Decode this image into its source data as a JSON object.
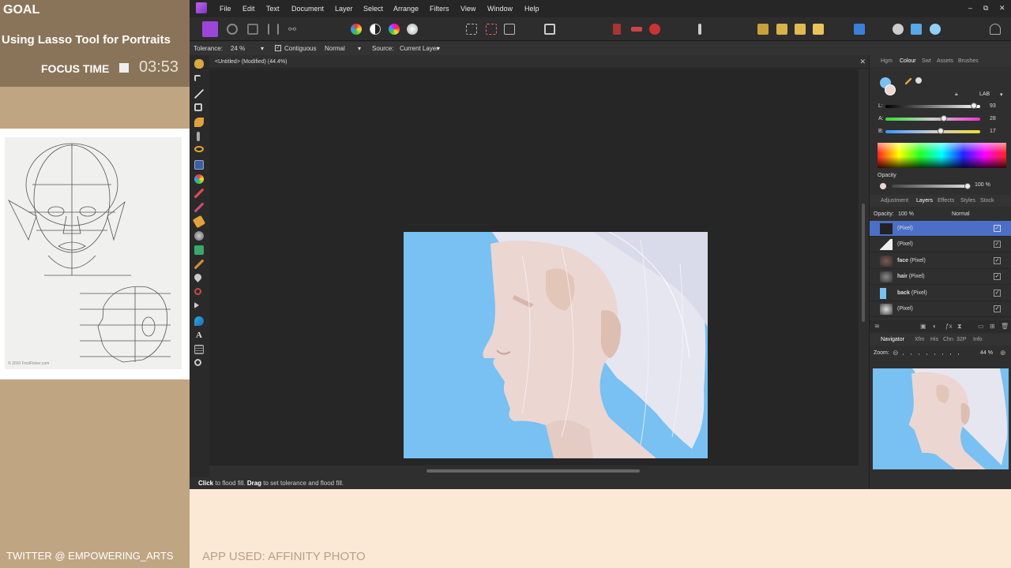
{
  "stream": {
    "goal_label": "GOAL",
    "goal_title": "Using Lasso Tool for Portraits",
    "focus_label": "FOCUS TIME",
    "focus_time": "03:53",
    "twitter": "TWITTER @ EMPOWERING_ARTS",
    "app_used": "APP USED: AFFINITY PHOTO",
    "ref_caption": "© 2010 FredFisher.com"
  },
  "menu": [
    "File",
    "Edit",
    "Text",
    "Document",
    "Layer",
    "Select",
    "Arrange",
    "Filters",
    "View",
    "Window",
    "Help"
  ],
  "window_controls": [
    "–",
    "⧉",
    "✕"
  ],
  "context": {
    "tolerance_label": "Tolerance:",
    "tolerance_value": "24 %",
    "contiguous_label": "Contiguous",
    "blend_mode": "Normal",
    "source_label": "Source:",
    "source_value": "Current Layer"
  },
  "document": {
    "title": "<Untitled> (Modified) (44.4%)",
    "close": "✕"
  },
  "status": {
    "click": "Click",
    "click_text": " to flood fill. ",
    "drag": "Drag",
    "drag_text": " to set tolerance and flood fill."
  },
  "colour_panel": {
    "tabs": [
      "Hgm",
      "Colour",
      "Swt",
      "Assets",
      "Brushes"
    ],
    "active_tab": "Colour",
    "model": "LAB",
    "sliders": [
      {
        "label": "L:",
        "value": "93",
        "level": 0.93
      },
      {
        "label": "A:",
        "value": "28",
        "level": 0.62
      },
      {
        "label": "B:",
        "value": "17",
        "level": 0.58
      }
    ],
    "opacity_label": "Opacity",
    "opacity_value": "100 %"
  },
  "layers_panel": {
    "tabs": [
      "Adjustment",
      "Layers",
      "Effects",
      "Styles",
      "Stock"
    ],
    "active_tab": "Layers",
    "opacity_label": "Opacity:",
    "opacity_value": "100 %",
    "blend": "Normal",
    "layers": [
      {
        "name": "",
        "type": "(Pixel)",
        "selected": true
      },
      {
        "name": "",
        "type": "(Pixel)",
        "selected": false
      },
      {
        "name": "face",
        "type": "(Pixel)",
        "selected": false
      },
      {
        "name": "hair",
        "type": "(Pixel)",
        "selected": false
      },
      {
        "name": "back",
        "type": "(Pixel)",
        "selected": false
      },
      {
        "name": "",
        "type": "(Pixel)",
        "selected": false
      }
    ]
  },
  "navigator_panel": {
    "tabs": [
      "Navigator",
      "Xfm",
      "His",
      "Chn",
      "32P",
      "Info"
    ],
    "active_tab": "Navigator",
    "zoom_label": "Zoom:",
    "zoom_value": "44 %"
  },
  "colors": {
    "canvas_sky": "#78c1f2",
    "skin": "#ecd6d2",
    "hair": "#eaeaf2",
    "selection": "#4b6fc6",
    "app_accent": "#9b46d8"
  }
}
